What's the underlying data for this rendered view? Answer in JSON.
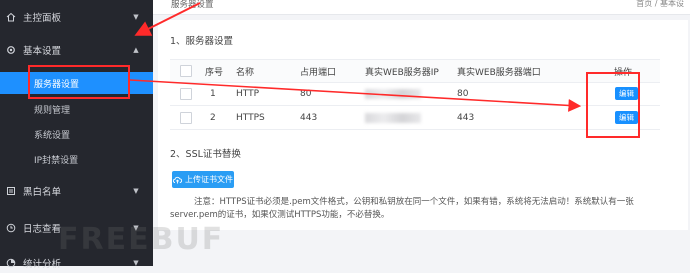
{
  "sidebar": {
    "items": [
      {
        "label": "主控面板",
        "icon": "home-icon"
      },
      {
        "label": "基本设置",
        "icon": "gear-icon"
      },
      {
        "label": "黑白名单",
        "icon": "list-icon"
      },
      {
        "label": "日志查看",
        "icon": "clock-icon"
      },
      {
        "label": "统计分析",
        "icon": "chart-icon"
      }
    ],
    "submenu": [
      {
        "label": "服务器设置"
      },
      {
        "label": "规则管理"
      },
      {
        "label": "系统设置"
      },
      {
        "label": "IP封禁设置"
      }
    ]
  },
  "topbar": {
    "breadcrumb": "服务器设置",
    "breadcrumb_right": "首页 / 基本设"
  },
  "section1": {
    "title": "1、服务器设置"
  },
  "table": {
    "headers": [
      "序号",
      "名称",
      "占用端口",
      "真实WEB服务器IP",
      "真实WEB服务器端口",
      "操作"
    ],
    "rows": [
      {
        "index": "1",
        "name": "HTTP",
        "port": "80",
        "real_port": "80",
        "action": "编辑"
      },
      {
        "index": "2",
        "name": "HTTPS",
        "port": "443",
        "real_port": "443",
        "action": "编辑"
      }
    ]
  },
  "section2": {
    "title": "2、SSL证书替换"
  },
  "upload_button": "上传证书文件",
  "note": {
    "line1": "注意：HTTPS证书必须是.pem文件格式，公钥和私钥放在同一个文件，如果有错，系统将无法启动！系统默认有一张",
    "line2": "server.pem的证书，如果仅测试HTTPS功能，不必替换。"
  },
  "watermark": "FREEBUF",
  "colors": {
    "sidebar_bg": "#25272e",
    "active": "#1e90ff",
    "button": "#1890ff",
    "annotation": "#ff2a2a"
  }
}
